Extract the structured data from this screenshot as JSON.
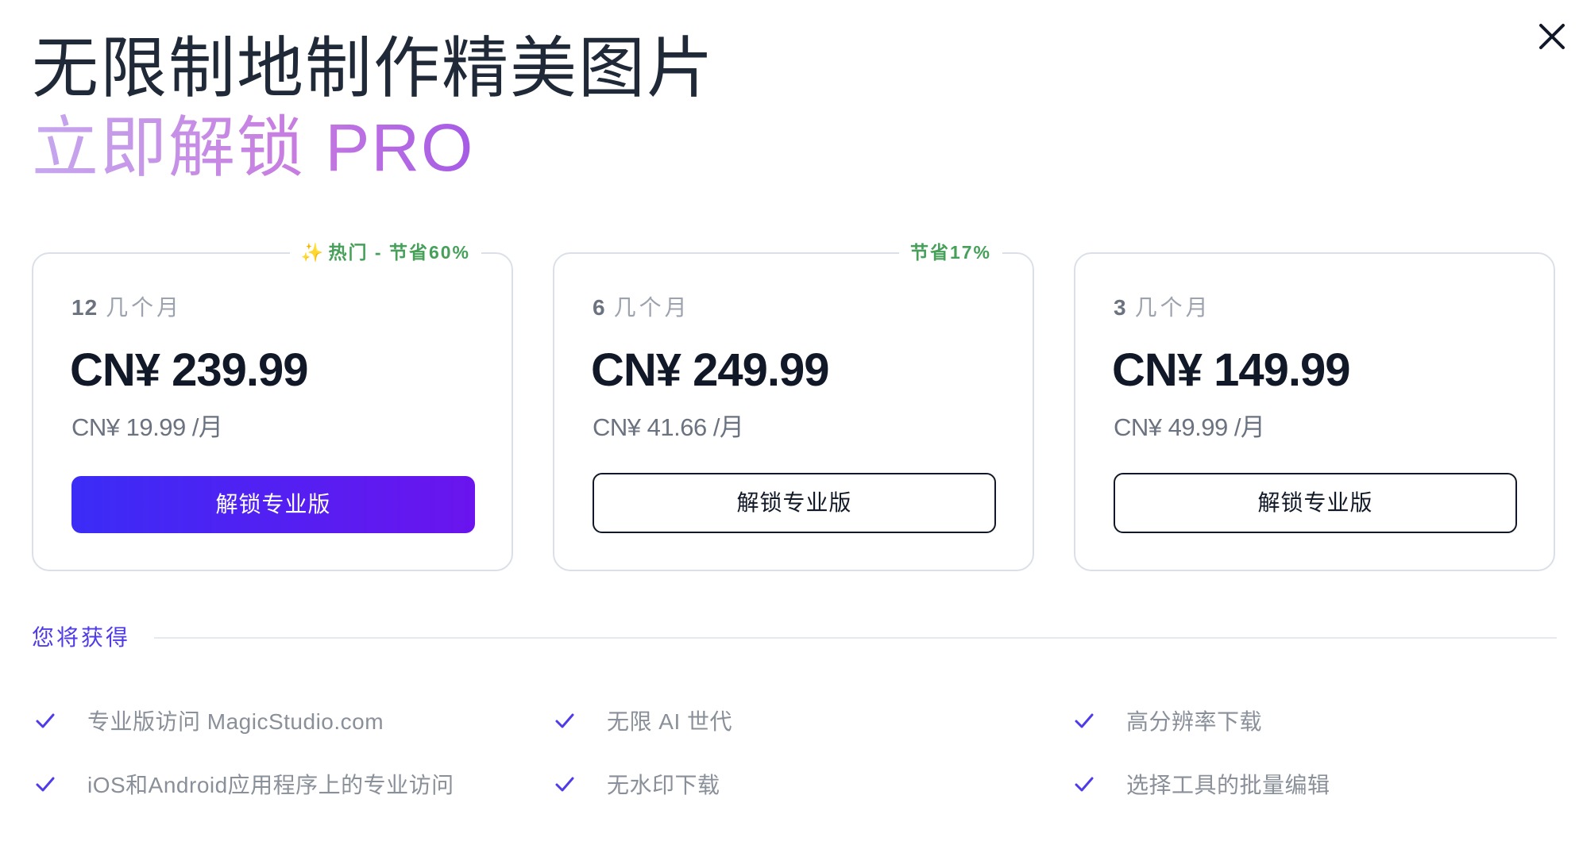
{
  "header": {
    "title": "无限制地制作精美图片",
    "subtitle": "立即解锁 PRO",
    "close_icon": "close-icon"
  },
  "plans": [
    {
      "badge_icon": "sparkle-icon",
      "badge_icon_glyph": "✨",
      "badge": "热门 - 节省60%",
      "duration_number": "12",
      "duration_unit": "几个月",
      "price": "CN¥ 239.99",
      "per_month": "CN¥ 19.99 /月",
      "cta": "解锁专业版",
      "cta_style": "primary"
    },
    {
      "badge": "节省17%",
      "duration_number": "6",
      "duration_unit": "几个月",
      "price": "CN¥ 249.99",
      "per_month": "CN¥ 41.66 /月",
      "cta": "解锁专业版",
      "cta_style": "outline"
    },
    {
      "badge": "",
      "duration_number": "3",
      "duration_unit": "几个月",
      "price": "CN¥ 149.99",
      "per_month": "CN¥ 49.99 /月",
      "cta": "解锁专业版",
      "cta_style": "outline"
    }
  ],
  "benefits": {
    "title": "您将获得",
    "check_icon": "check-icon",
    "items": [
      "专业版访问 MagicStudio.com",
      "无限 AI 世代",
      "高分辨率下载",
      "iOS和Android应用程序上的专业访问",
      "无水印下载",
      "选择工具的批量编辑"
    ]
  },
  "colors": {
    "accent": "#4f3ce8",
    "primary_button_start": "#3b2cf6",
    "primary_button_end": "#6a14ee",
    "badge_green": "#47a05a",
    "subtitle_gradient": [
      "#c6a8ee",
      "#c77ce0",
      "#a55ae6"
    ],
    "text_dark": "#111827",
    "text_muted": "#6b7280"
  }
}
